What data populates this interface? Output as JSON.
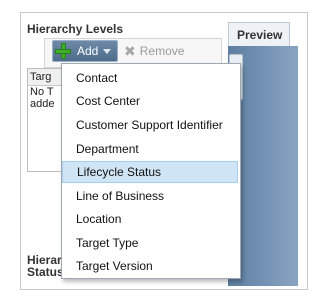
{
  "panel": {
    "title": "Hierarchy Levels",
    "bottom_label": "Hierarchy Status"
  },
  "toolbar": {
    "add_label": "Add",
    "remove_label": "Remove",
    "add_icon": "plus-icon",
    "remove_icon": "remove-icon"
  },
  "list": {
    "header": "Targ",
    "empty_text_line1": "No T",
    "empty_text_line2": "adde"
  },
  "preview": {
    "tab_label": "Preview"
  },
  "menu": {
    "items": [
      {
        "label": "Contact"
      },
      {
        "label": "Cost Center"
      },
      {
        "label": "Customer Support Identifier"
      },
      {
        "label": "Department"
      },
      {
        "label": "Lifecycle Status",
        "highlighted": true
      },
      {
        "label": "Line of Business"
      },
      {
        "label": "Location"
      },
      {
        "label": "Target Type"
      },
      {
        "label": "Target Version"
      }
    ],
    "highlight_color": "#cfe5f6"
  }
}
